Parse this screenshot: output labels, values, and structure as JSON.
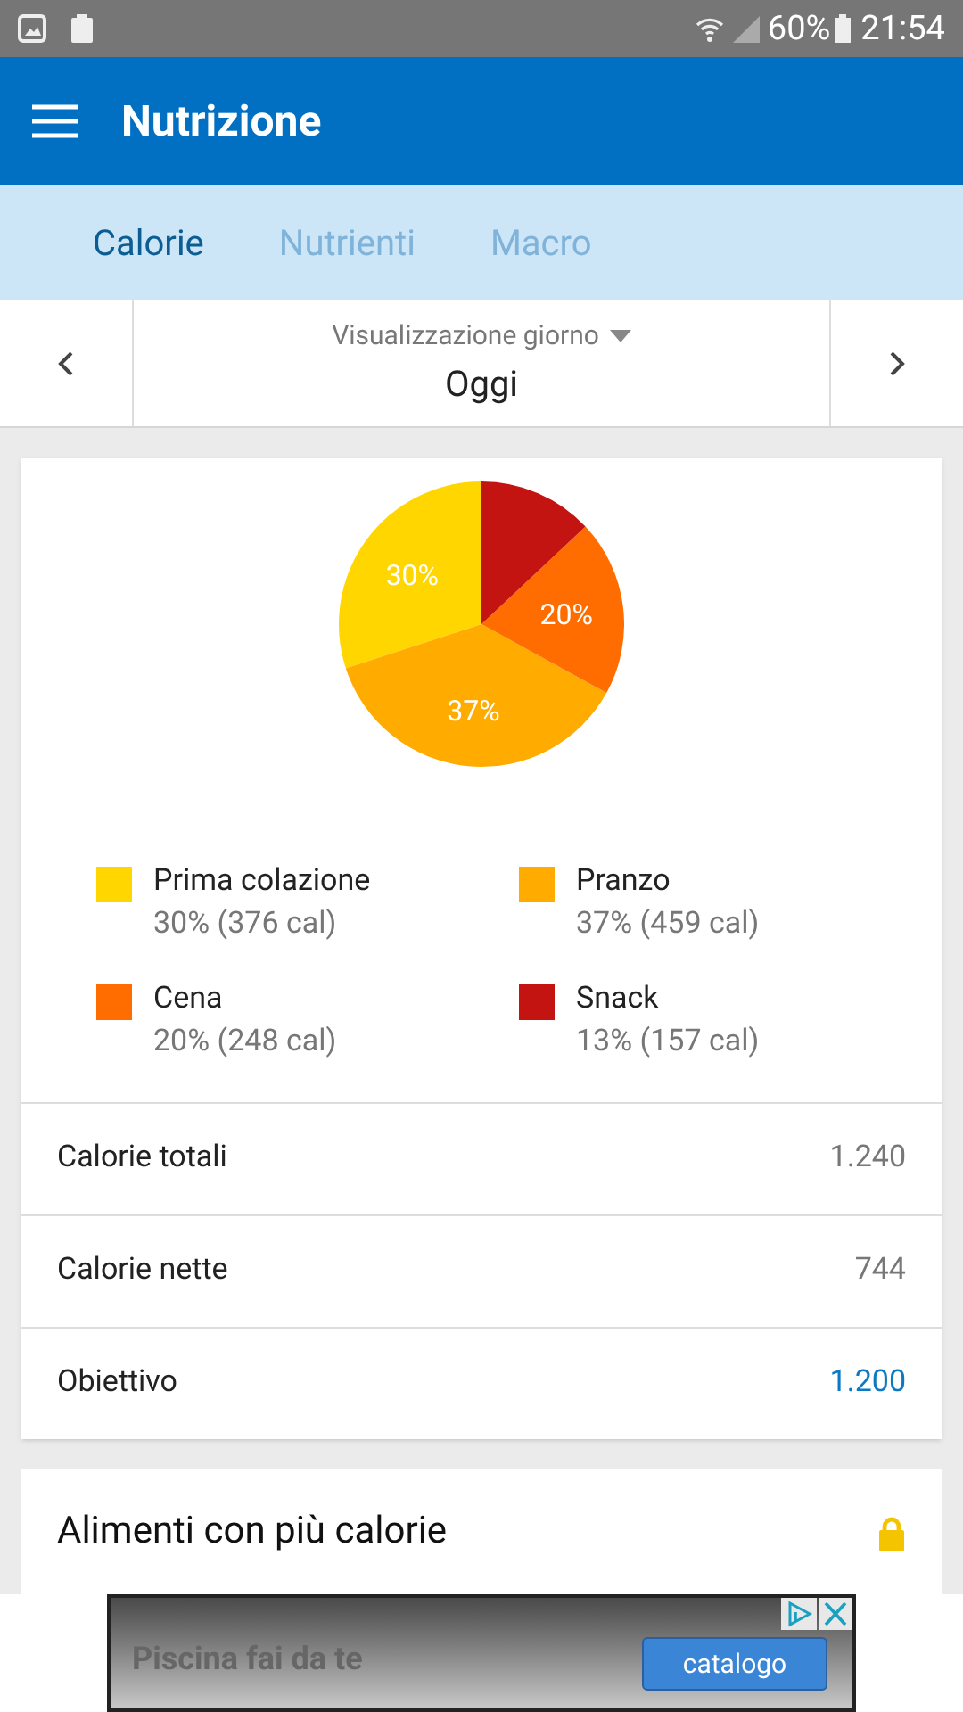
{
  "status_bar": {
    "battery": "60%",
    "time": "21:54"
  },
  "header": {
    "title": "Nutrizione"
  },
  "tabs": [
    {
      "label": "Calorie",
      "selected": true
    },
    {
      "label": "Nutrienti",
      "selected": false
    },
    {
      "label": "Macro",
      "selected": false
    }
  ],
  "day_selector": {
    "mode": "Visualizzazione giorno",
    "day": "Oggi"
  },
  "chart_data": {
    "type": "pie",
    "categories": [
      "Prima colazione",
      "Pranzo",
      "Cena",
      "Snack"
    ],
    "values": [
      30,
      37,
      20,
      13
    ],
    "value_labels": [
      "30%",
      "37%",
      "20%",
      null
    ]
  },
  "legend": [
    {
      "detail": "30% (376 cal)",
      "color": "#ffd600"
    },
    {
      "detail": "37% (459 cal)",
      "color": "#ffab00"
    },
    {
      "detail": "20% (248 cal)",
      "color": "#ff6d00"
    },
    {
      "detail": "13% (157 cal)",
      "color": "#c41411"
    }
  ],
  "totals": [
    {
      "label": "Calorie totali",
      "value": "1.240",
      "highlight": false
    },
    {
      "label": "Calorie nette",
      "value": "744",
      "highlight": false
    },
    {
      "label": "Obiettivo",
      "value": "1.200",
      "highlight": true
    }
  ],
  "top_foods": {
    "title": "Alimenti con più calorie",
    "locked": true
  },
  "ad": {
    "text": "Piscina fai da te",
    "button": "catalogo"
  }
}
